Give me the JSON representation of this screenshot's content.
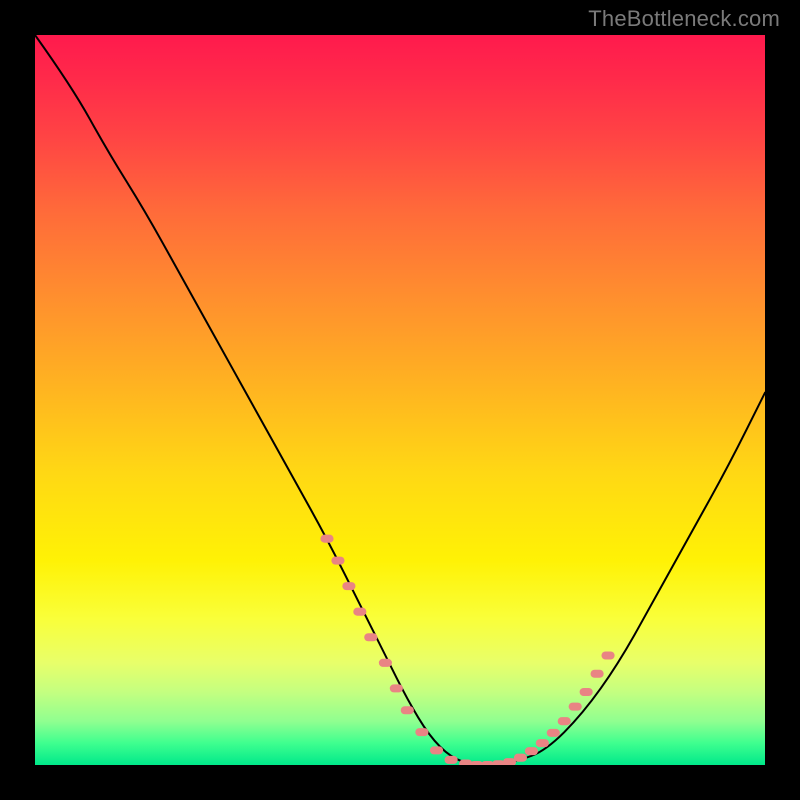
{
  "credit": {
    "text": "TheBottleneck.com"
  },
  "chart_data": {
    "type": "line",
    "title": "",
    "xlabel": "",
    "ylabel": "",
    "xlim": [
      0,
      100
    ],
    "ylim": [
      0,
      100
    ],
    "series": [
      {
        "name": "bottleneck-curve",
        "x": [
          0,
          5,
          10,
          15,
          20,
          25,
          30,
          35,
          40,
          45,
          48,
          51,
          54,
          57,
          60,
          63,
          66,
          70,
          75,
          80,
          85,
          90,
          95,
          100
        ],
        "values": [
          100,
          93,
          84,
          76,
          67,
          58,
          49,
          40,
          31,
          21,
          15,
          9,
          4,
          1,
          0,
          0,
          0.5,
          2,
          7,
          14,
          23,
          32,
          41,
          51
        ],
        "stroke": "#000000",
        "stroke_width": 2
      }
    ],
    "data_markers": {
      "comment": "salmon dotted overlay near the curve bottom",
      "color": "#e98484",
      "points": [
        [
          40,
          31
        ],
        [
          41.5,
          28
        ],
        [
          43,
          24.5
        ],
        [
          44.5,
          21
        ],
        [
          46,
          17.5
        ],
        [
          48,
          14
        ],
        [
          49.5,
          10.5
        ],
        [
          51,
          7.5
        ],
        [
          53,
          4.5
        ],
        [
          55,
          2
        ],
        [
          57,
          0.7
        ],
        [
          59,
          0.2
        ],
        [
          60.5,
          0
        ],
        [
          62,
          0
        ],
        [
          63.5,
          0.1
        ],
        [
          65,
          0.4
        ],
        [
          66.5,
          1
        ],
        [
          68,
          1.9
        ],
        [
          69.5,
          3
        ],
        [
          71,
          4.4
        ],
        [
          72.5,
          6
        ],
        [
          74,
          8
        ],
        [
          75.5,
          10
        ],
        [
          77,
          12.5
        ],
        [
          78.5,
          15
        ]
      ]
    },
    "background_gradient": {
      "direction": "top-to-bottom",
      "stops": [
        {
          "pos": 0.0,
          "color": "#ff1a4d"
        },
        {
          "pos": 0.5,
          "color": "#ffc51a"
        },
        {
          "pos": 0.8,
          "color": "#fbff40"
        },
        {
          "pos": 1.0,
          "color": "#00e98a"
        }
      ]
    }
  }
}
